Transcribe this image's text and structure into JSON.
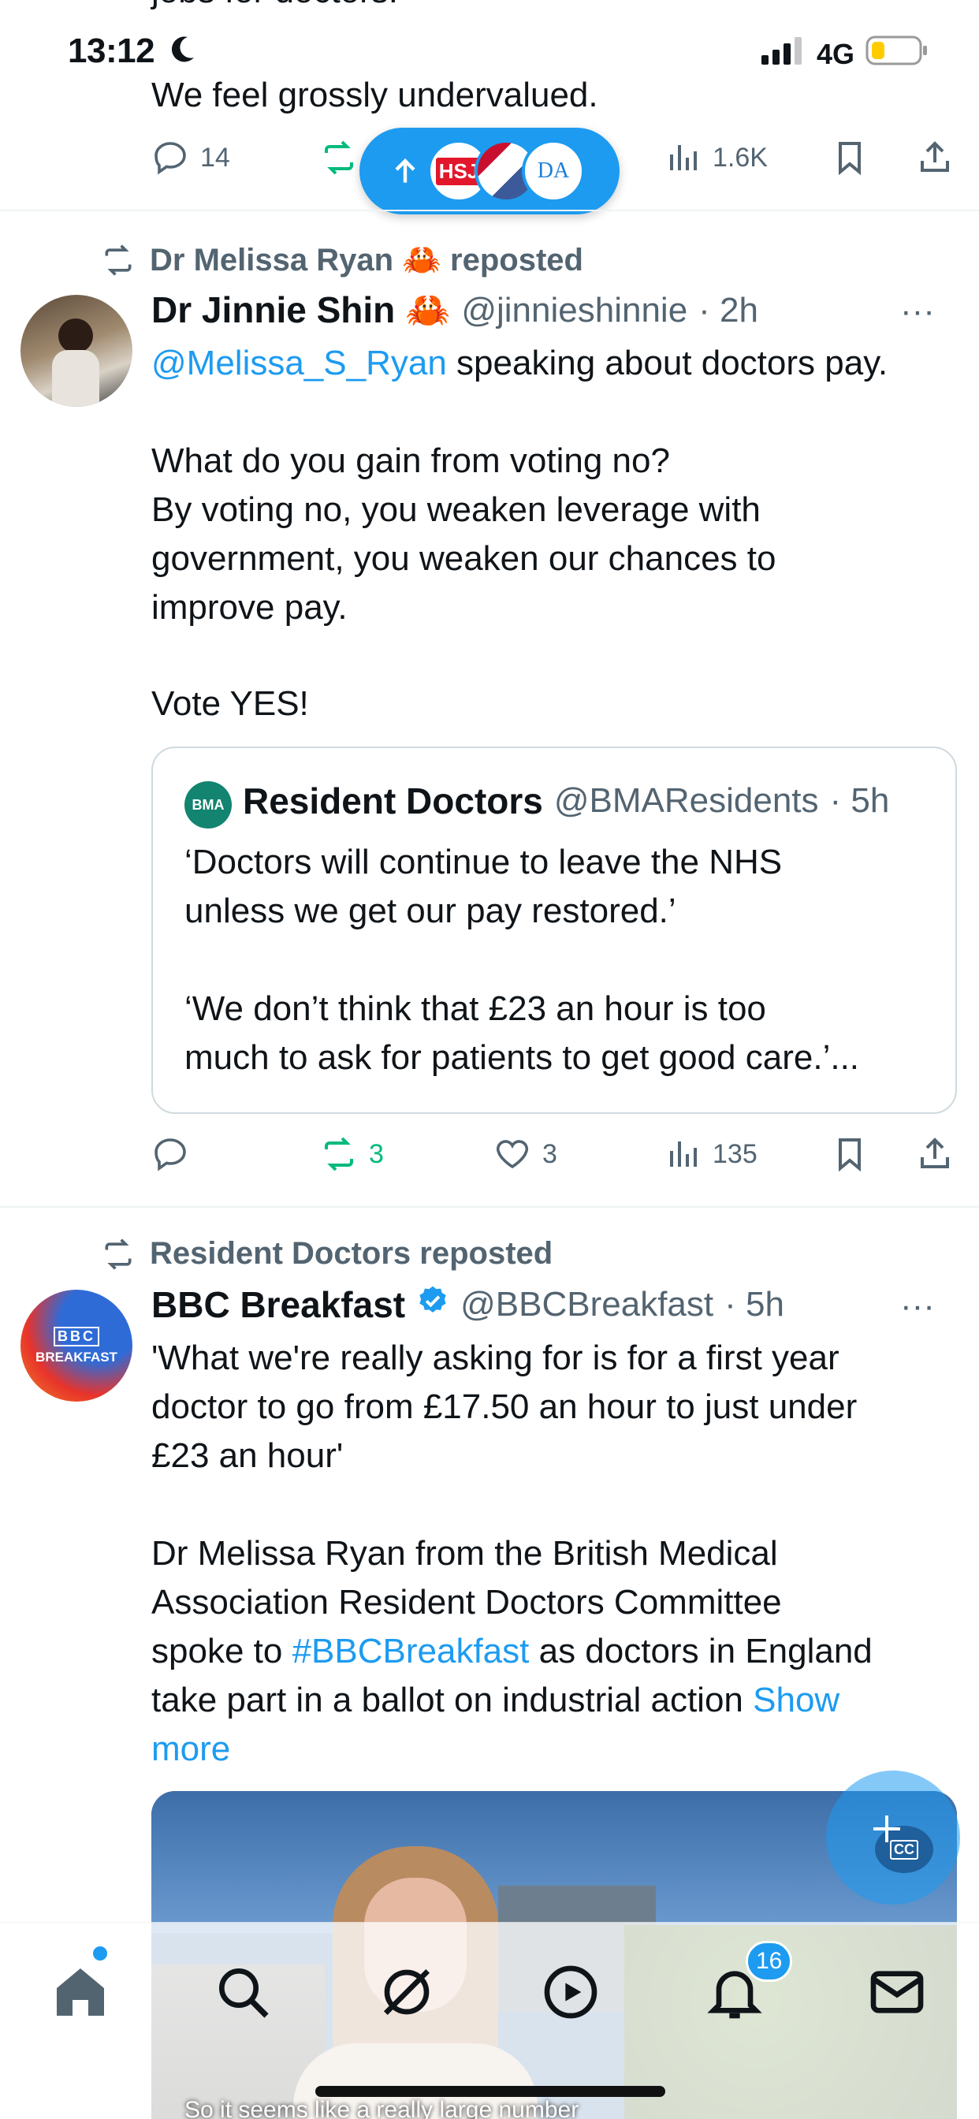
{
  "status_bar": {
    "time": "13:12",
    "network": "4G"
  },
  "tweet_prev": {
    "clipped_line": "jobs for doctors.",
    "last_line": "We feel grossly undervalued.",
    "replies": "14",
    "views": "1.6K"
  },
  "new_posts_pill": {
    "label": "HSJ",
    "label2": "DA"
  },
  "tweet1": {
    "repost_label": "Dr Melissa Ryan 🦀 reposted",
    "name": "Dr Jinnie Shin 🦀",
    "handle": "@jinnieshinnie",
    "time": "· 2h",
    "mention": "@Melissa_S_Ryan",
    "line1_rest": " speaking about doctors pay.",
    "para2_l1": "What do you gain from voting no?",
    "para2_l2": "By voting no, you weaken leverage with",
    "para2_l3": "government, you weaken our chances to",
    "para2_l4": "improve pay.",
    "para3": "Vote YES!",
    "quote": {
      "avatar_text": "BMA",
      "name": "Resident Doctors",
      "handle": "@BMAResidents",
      "time": "· 5h",
      "l1": "‘Doctors will continue to leave the NHS",
      "l2": "unless we get our pay restored.’",
      "l3": "‘We don’t think that £23 an hour is too",
      "l4": "much to ask for patients to get good care.’..."
    },
    "reposts": "3",
    "likes": "3",
    "views": "135"
  },
  "tweet2": {
    "repost_label": "Resident Doctors reposted",
    "avatar_text_top": "BBC",
    "avatar_text_bottom": "BREAKFAST",
    "name": "BBC Breakfast",
    "handle": "@BBCBreakfast",
    "time": "· 5h",
    "p1_l1": "'What we're really asking for is for a first year",
    "p1_l2": "doctor to go from £17.50 an hour to just under",
    "p1_l3": "£23 an hour'",
    "p2_l1": "Dr Melissa Ryan from the British Medical",
    "p2_l2": "Association Resident Doctors Committee",
    "p2_l3_a": "spoke to ",
    "p2_l3_hashtag": "#BBCBreakfast",
    "p2_l3_b": " as doctors in England",
    "p2_l4": "take part in a ballot on industrial action ",
    "show_more_a": "Show",
    "show_more_b": "more",
    "video_caption": "So it seems like a really large number"
  },
  "fab": {
    "icon": "compose-plus-icon",
    "label": "CC"
  },
  "tab_bar": {
    "notifications_badge": "16"
  },
  "colors": {
    "accent": "#1d9bf0",
    "repost_green": "#00ba7c",
    "muted": "#536471"
  }
}
